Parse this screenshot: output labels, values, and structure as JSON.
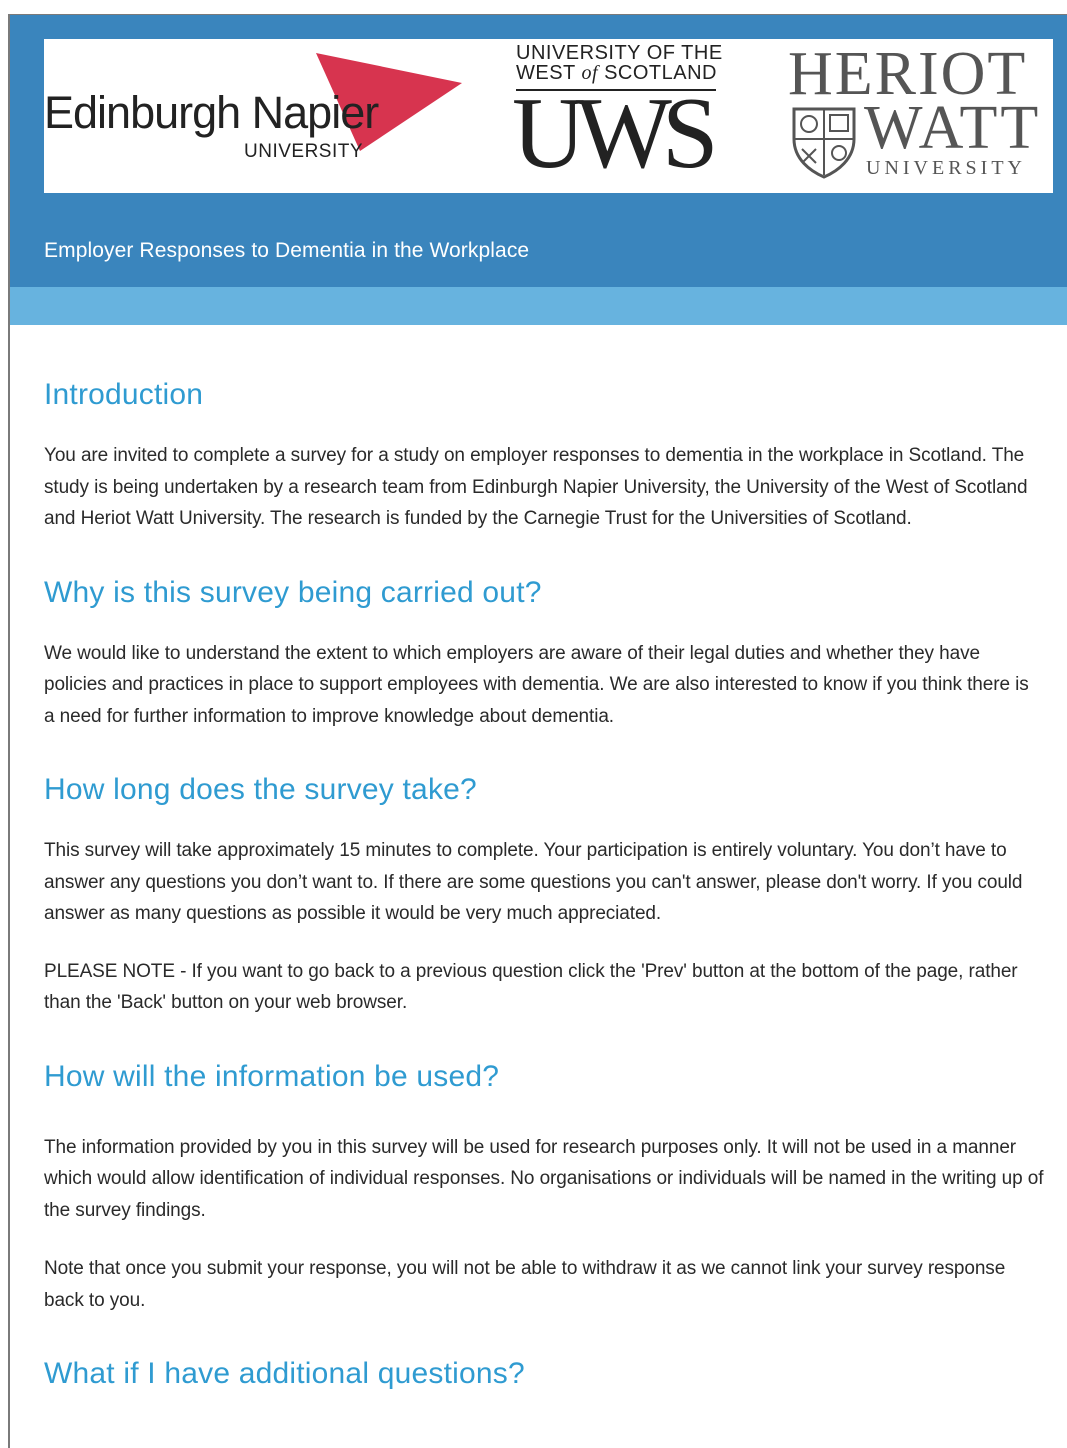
{
  "header": {
    "logos": {
      "napier": {
        "name": "Edinburgh Napier",
        "sub": "UNIVERSITY",
        "accent": "#d7344f"
      },
      "uws": {
        "line1": "UNIVERSITY OF THE",
        "line2_a": "WEST ",
        "line2_of": "of",
        "line2_b": " SCOTLAND",
        "big": "UWS"
      },
      "heriot_watt": {
        "line1": "HERIOT",
        "line2": "WATT",
        "line3": "UNIVERSITY"
      }
    },
    "survey_title": "Employer Responses to Dementia in the Workplace",
    "colors": {
      "band": "#3a85bd",
      "light_band": "#67b3df",
      "heading": "#2f9bd1"
    }
  },
  "sections": [
    {
      "heading": "Introduction",
      "paragraphs": [
        "You are invited to complete a survey for a study on employer responses to dementia in the workplace in Scotland. The study is being undertaken by a research team from Edinburgh Napier University, the University of the West of Scotland and Heriot Watt University. The research is funded by the Carnegie Trust for the Universities of Scotland."
      ]
    },
    {
      "heading": "Why is this survey being carried out?",
      "paragraphs": [
        "We would like to understand the extent to which employers are aware of their legal duties and whether they have policies and practices in place to support employees with dementia.  We are also interested to know if you think there is a need for further information to improve knowledge about dementia."
      ]
    },
    {
      "heading": "How long does the survey take?",
      "paragraphs": [
        "This survey will take approximately 15 minutes to complete. Your participation is entirely voluntary. You don’t have to answer any questions you don’t want to.  If there are some questions you can't answer, please don't worry.  If you could answer as many questions as possible it would be very much appreciated.",
        "PLEASE NOTE - If you want to go back to a previous question click the 'Prev' button at the bottom of the page, rather than the 'Back' button on your web browser."
      ]
    },
    {
      "heading": "How will the information be used?",
      "paragraphs": [
        "The information provided by you in this survey will be used for research purposes only. It will not be used in a manner which would allow identification of individual responses. No organisations or individuals will be named in the writing up of the survey findings.",
        "Note that once you submit your response, you will not be able to withdraw it as we cannot link your survey response back to you."
      ]
    },
    {
      "heading": "What if I have additional questions?",
      "paragraphs": []
    }
  ]
}
